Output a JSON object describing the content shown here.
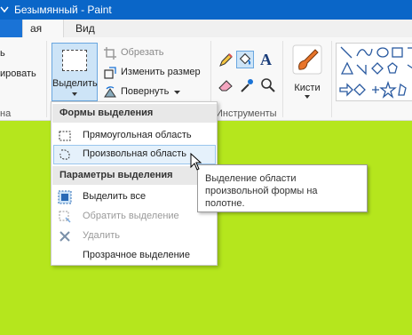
{
  "window": {
    "title": "Безымянный - Paint"
  },
  "tabs": {
    "file": "",
    "home": "ая",
    "view": "Вид"
  },
  "ribbon": {
    "clipboard": {
      "cut_label": "ь",
      "copy_label": "ировать",
      "group_label": "на"
    },
    "image": {
      "select_label": "Выделить",
      "crop_label": "Обрезать",
      "resize_label": "Изменить размер",
      "rotate_label": "Повернуть"
    },
    "tools": {
      "group_label": "Инструменты",
      "text_glyph": "A"
    },
    "brushes": {
      "label": "Кисти"
    }
  },
  "select_menu": {
    "section_shapes": "Формы выделения",
    "rect_label": "Прямоугольная область",
    "free_label": "Произвольная область",
    "section_options": "Параметры выделения",
    "select_all_label": "Выделить все",
    "invert_label": "Обратить выделение",
    "delete_label": "Удалить",
    "transparent_label": "Прозрачное выделение"
  },
  "tooltip": {
    "text": "Выделение области произвольной формы на полотне."
  },
  "colors": {
    "canvas": "#b5e61d",
    "titlebar": "#0a66c8",
    "accent": "#cde4f7"
  }
}
